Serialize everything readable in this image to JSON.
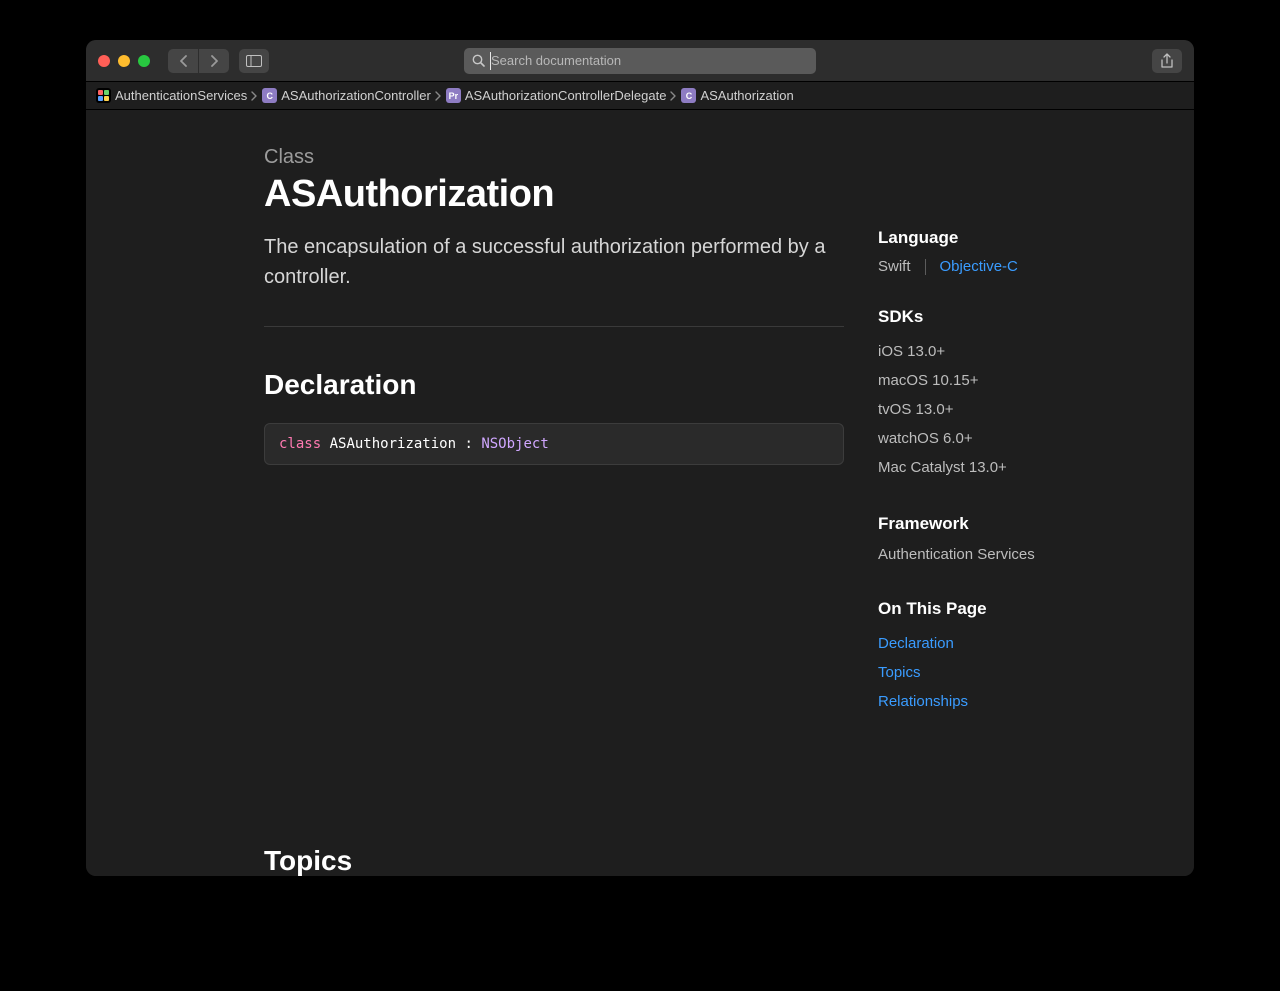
{
  "search": {
    "placeholder": "Search documentation"
  },
  "breadcrumbs": [
    {
      "label": "AuthenticationServices"
    },
    {
      "label": "ASAuthorizationController",
      "badge": "C"
    },
    {
      "label": "ASAuthorizationControllerDelegate",
      "badge": "Pr"
    },
    {
      "label": "ASAuthorization",
      "badge": "C"
    }
  ],
  "page": {
    "eyebrow": "Class",
    "title": "ASAuthorization",
    "summary": "The encapsulation of a successful authorization performed by a controller.",
    "declaration_heading": "Declaration",
    "declaration": {
      "keyword": "class",
      "name": "ASAuthorization",
      "sep": " : ",
      "base": "NSObject"
    },
    "topics_heading": "Topics"
  },
  "aside": {
    "language_heading": "Language",
    "language_options": [
      "Swift",
      "Objective-C"
    ],
    "sdks_heading": "SDKs",
    "sdks": [
      "iOS 13.0+",
      "macOS 10.15+",
      "tvOS 13.0+",
      "watchOS 6.0+",
      "Mac Catalyst 13.0+"
    ],
    "framework_heading": "Framework",
    "framework": "Authentication Services",
    "on_this_page_heading": "On This Page",
    "toc": [
      "Declaration",
      "Topics",
      "Relationships"
    ]
  }
}
